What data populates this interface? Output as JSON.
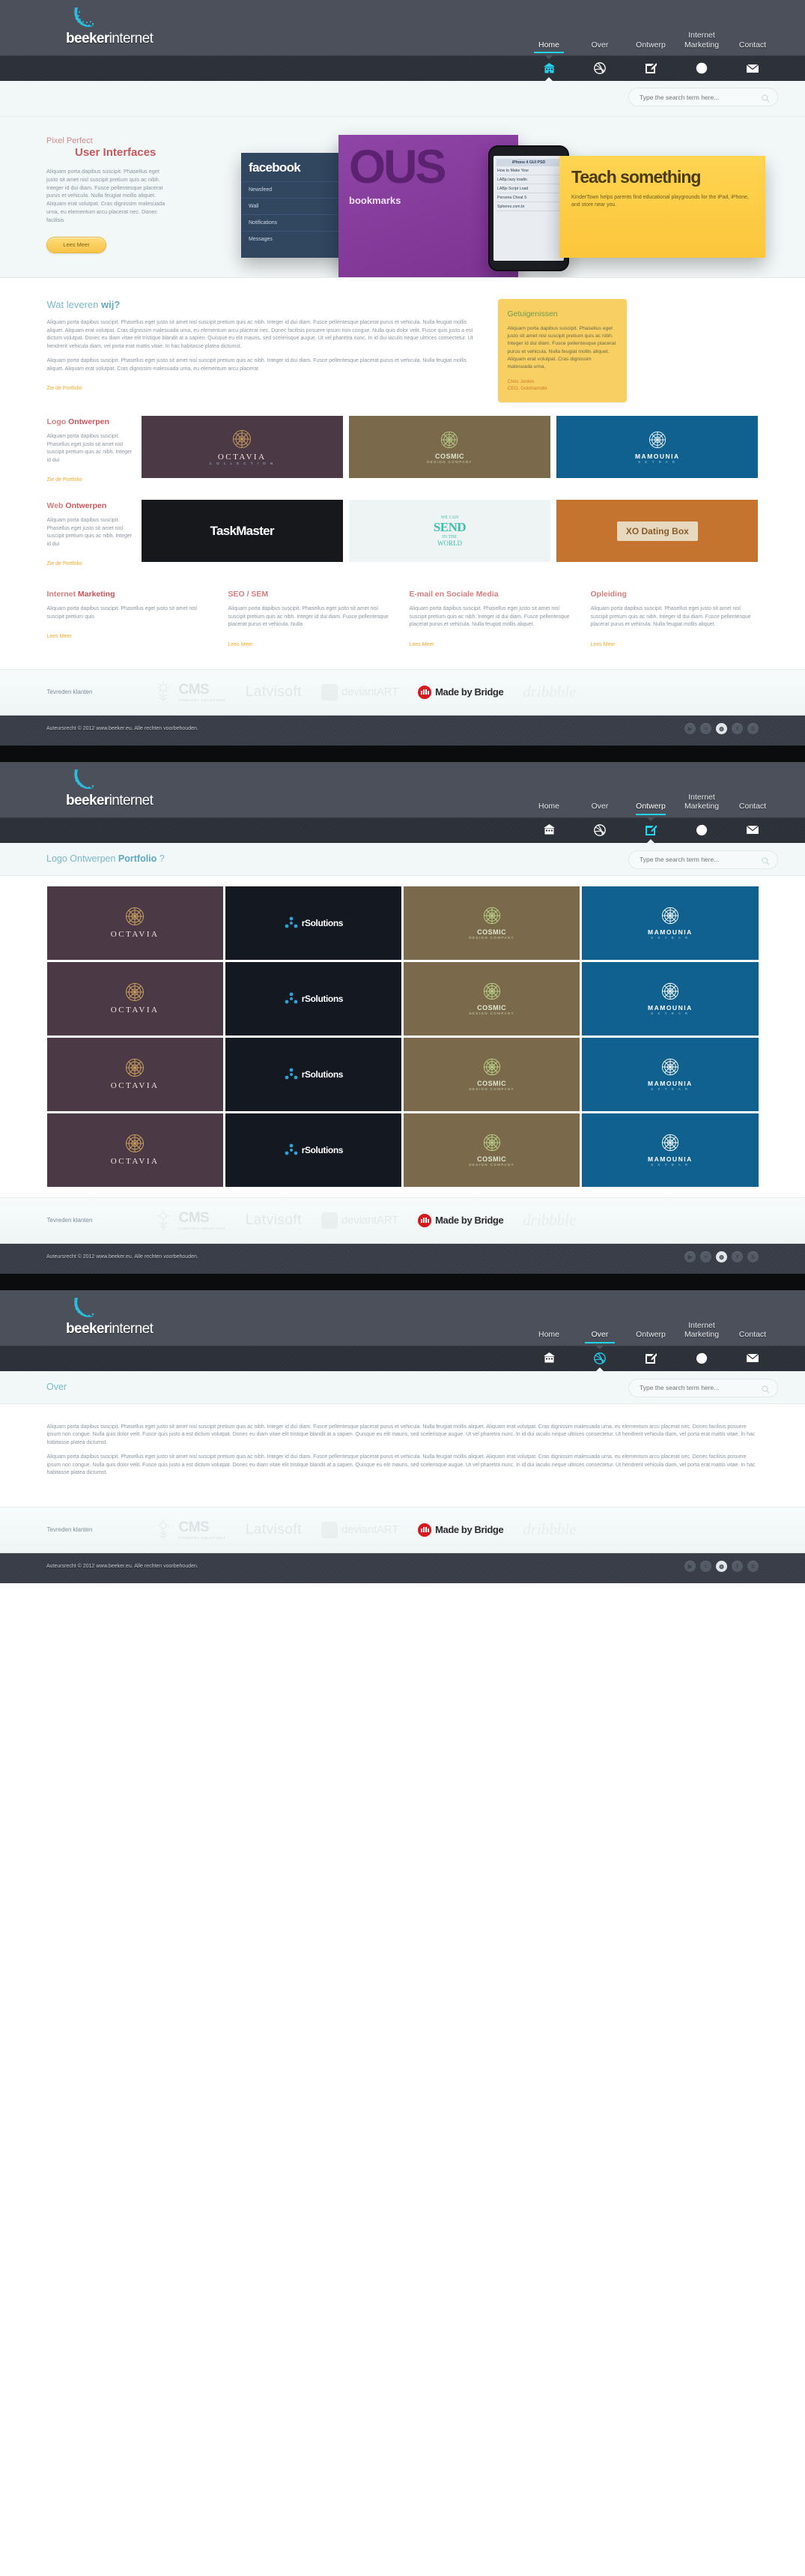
{
  "brand": {
    "name_bold": "beeker",
    "name_thin": "internet"
  },
  "nav": {
    "items": [
      {
        "label": "Home",
        "icon": "home-icon"
      },
      {
        "label": "Over",
        "icon": "dribbble-ball-icon"
      },
      {
        "label": "Ontwerp",
        "icon": "pencil-square-icon"
      },
      {
        "label": "Internet Marketing",
        "icon": "pie-chart-icon"
      },
      {
        "label": "Contact",
        "icon": "envelope-icon"
      }
    ]
  },
  "search": {
    "placeholder": "Type the search term here...",
    "value": ""
  },
  "hero": {
    "kicker": "Pixel Perfect",
    "title": "User Interfaces",
    "paragraph": "Aliquam porta dapibus suscipit. Phasellus eget justo sit amet nisl suscipit pretium quis ac nibh. Integer id dui diam. Fusce pellentesque placerat purus et vehicula. Nulla feugiat mollis aliquet. Aliquam erat volutpat. Cras dignissim malesuada urna, eu elementum arcu placerat nec. Donec facilisis",
    "button": "Lees Meer",
    "slides": {
      "facebook": {
        "brand": "facebook",
        "rows": [
          "Newsfeed",
          "Wall",
          "Notifications",
          "Messages"
        ]
      },
      "purple": {
        "big": "OUS",
        "sub": "bookmarks"
      },
      "phone": {
        "header": "iPhone 4 GUI PSD",
        "rows": [
          "How to Make Your",
          "LABju lazy loadin",
          "LABjs Script Load",
          "Persona Cheat S"
        ],
        "footer": "Spheres.com.br"
      },
      "yellow": {
        "title": "Teach something",
        "paragraph": "KinderTown helps parents find educational playgrounds for the iPad, iPhone, and store near you."
      }
    }
  },
  "sections": {
    "services": {
      "title_normal": "Wat leveren ",
      "title_bold": "wij?",
      "paragraph1": "Aliquam porta dapibus suscipit. Phasellus eget justo sit amet nisl suscipit pretium quis ac nibh. Integer id dui diam. Fusce pellentesque placerat purus et vehicula. Nulla feugiat mollis aliquet. Aliquam erat volutpat. Cras dignissim malesuada urna, eu elementum arcu placerat nec. Donec facilisis posuere ipsum non congue. Nulla quis dolor velit. Fusce quis justo a est dictum volutpat. Donec eu diam vitae elit tristique blandit at a sapien. Quisque eu elit mauris, sed scelerisque augue. Ut vel pharetra nunc. In id dui iaculis neque ultrices consectetur. Ut hendrerit vehicula diam, vel porta erat mattis vitae. In hac habitasse platea dictumst.",
      "paragraph2": "Aliquam porta dapibus suscipit. Phasellus eget justo sit amet nisl suscipit pretium quis ac nibh. Integer id dui diam. Fusce pellentesque placerat purus et vehicula. Nulla feugiat mollis aliquet. Aliquam erat volutpat. Cras dignissim malesuada urna, eu elementum arcu placerat",
      "link": "Zie de Portfolio"
    },
    "testimonial": {
      "title": "Getuigenissen",
      "text": "Aliquam porta dapibus suscipit. Phasellus eget justo sit amet nisl suscipit pretium quis ac nibh. Integer id dui diam. Fusce pellentesque placerat purus et vehicula. Nulla feugiat mollis aliquet. Aliquam erat volutpat. Cras dignissim malesuada urna,",
      "author": "Chris Jenkin",
      "role": "CEO, Gotchamobi"
    },
    "logo_design": {
      "title_normal": "Logo ",
      "title_bold": "Ontwerpen",
      "paragraph": "Aliquam porta dapibus suscipit. Phasellus eget justo sit amet nisl suscipit pretium quis ac nibh. Integer id dui",
      "link": "Zie de Portfolio"
    },
    "web_design": {
      "title_normal": "Web ",
      "title_bold": "Ontwerpen",
      "paragraph": "Aliquam porta dapibus suscipit. Phasellus eget justo sit amet nisl suscipit pretium quis ac nibh. Integer id dui",
      "link": "Zie de Portfolio"
    }
  },
  "portfolio_logos": [
    {
      "name": "OCTAVIA",
      "sub": "C O L L E C T I O N",
      "theme": "logo-octavia"
    },
    {
      "name": "COSMIC",
      "sub": "DESIGN COMPANY",
      "theme": "logo-cosmic"
    },
    {
      "name": "MAMOUNIA",
      "sub": "S K Y   B A R",
      "theme": "logo-mamounia"
    },
    {
      "name": "rSolutions",
      "sub": "",
      "theme": "logo-rsol"
    }
  ],
  "web_shots": [
    {
      "name": "TaskMaster",
      "theme": "web-taskmaster"
    },
    {
      "name": "SEND",
      "theme": "web-send",
      "line1": "WE CAN",
      "line2": "SEND",
      "line3": "IN THE",
      "line4": "WORLD"
    },
    {
      "name": "XO Dating Box",
      "theme": "web-xo"
    }
  ],
  "four_columns": [
    {
      "title_normal": "Internet ",
      "title_bold": "Marketing",
      "text": "Aliquam porta dapibus suscipit. Phasellus eget justo sit amet nisl suscipit pretium quis",
      "link": "Lees Meer"
    },
    {
      "title_normal": "SEO / SEM",
      "title_bold": "",
      "text": "Aliquam porta dapibus suscipit. Phasellus eget justo sit amet nisl suscipit pretium quis ac nibh. Integer id dui diam. Fusce pellentesque placerat purus et vehicula. Nulla",
      "link": "Lees Meer"
    },
    {
      "title_normal": "E-mail en Sociale Media",
      "title_bold": "",
      "text": "Aliquam porta dapibus suscipit. Phasellus eget justo sit amet nisl suscipit pretium quis ac nibh. Integer id dui diam. Fusce pellentesque placerat purus et vehicula. Nulla feugiat mollis aliquet.",
      "link": "Lees Meer"
    },
    {
      "title_normal": "Opleiding",
      "title_bold": "",
      "text": "Aliquam porta dapibus suscipit. Phasellus eget justo sit amet nisl suscipit pretium quis ac nibh. Integer id dui diam. Fusce pellentesque placerat purus et vehicula. Nulla feugiat mollis aliquet.",
      "link": "Lees Meer"
    }
  ],
  "clients": {
    "label": "Tevreden klanten",
    "items": [
      {
        "name": "CMS",
        "sub": "COMFORT SOLUTIONS"
      },
      {
        "name": "Latvisoft"
      },
      {
        "name": "deviantART"
      },
      {
        "name": "Made by Bridge"
      },
      {
        "name": "dribbble"
      }
    ]
  },
  "footer": {
    "copyright": "Auteursrecht © 2012 www.beeker.eu. Alle rechten voorbehouden.",
    "socials": [
      "youtube-icon",
      "rss-icon",
      "dribbble-icon",
      "facebook-icon",
      "skype-icon"
    ]
  },
  "page_portfolio": {
    "title_normal": "Logo Ontwerpen ",
    "title_bold": "Portfolio",
    "title_suffix": " ?"
  },
  "page_over": {
    "title": "Over",
    "paragraph1": "Aliquam porta dapibus suscipit. Phasellus eget justo sit amet nisl suscipit pretium quis ac nibh. Integer id dui diam. Fusce pellentesque placerat purus et vehicula. Nulla feugiat mollis aliquet. Aliquam erat volutpat. Cras dignissim malesuada urna, eu elementum arcu placerat nec. Donec facilisis posuere ipsum non congue. Nulla quis dolor velit. Fusce quis justo a est dictum volutpat. Donec eu diam vitae elit tristique blandit at a sapien. Quisque eu elit mauris, sed scelerisque augue. Ut vel pharetra nunc. In id dui iaculis neque ultrices consectetur. Ut hendrerit vehicula diam, vel porta erat mattis vitae. In hac habitasse platea dictumst.",
    "paragraph2": "Aliquam porta dapibus suscipit. Phasellus eget justo sit amet nisl suscipit pretium quis ac nibh. Integer id dui diam. Fusce pellentesque placerat purus et vehicula. Nulla feugiat mollis aliquet. Aliquam erat volutpat. Cras dignissim malesuada urna, eu elementum arcu placerat nec. Donec facilisis posuere ipsum non congue. Nulla quis dolor velit. Fusce quis justo a est dictum volutpat. Donec eu diam vitae elit tristique blandit at a sapien. Quisque eu elit mauris, sed scelerisque augue. Ut vel pharetra nunc. In id dui iaculis neque ultrices consectetur. Ut hendrerit vehicula diam, vel porta erat mattis vitae. In hac habitasse platea dictumst."
  },
  "colors": {
    "accent_cyan": "#22d3ef",
    "header_gray": "#4b505a",
    "iconbar_dark": "#2e323a",
    "pale_bg": "#f2f7f7",
    "heading_blue": "#7bb8c9",
    "heading_red": "#c9565c",
    "link_yellow": "#f0a92c",
    "testimonial_bg": "#f7cf62"
  }
}
